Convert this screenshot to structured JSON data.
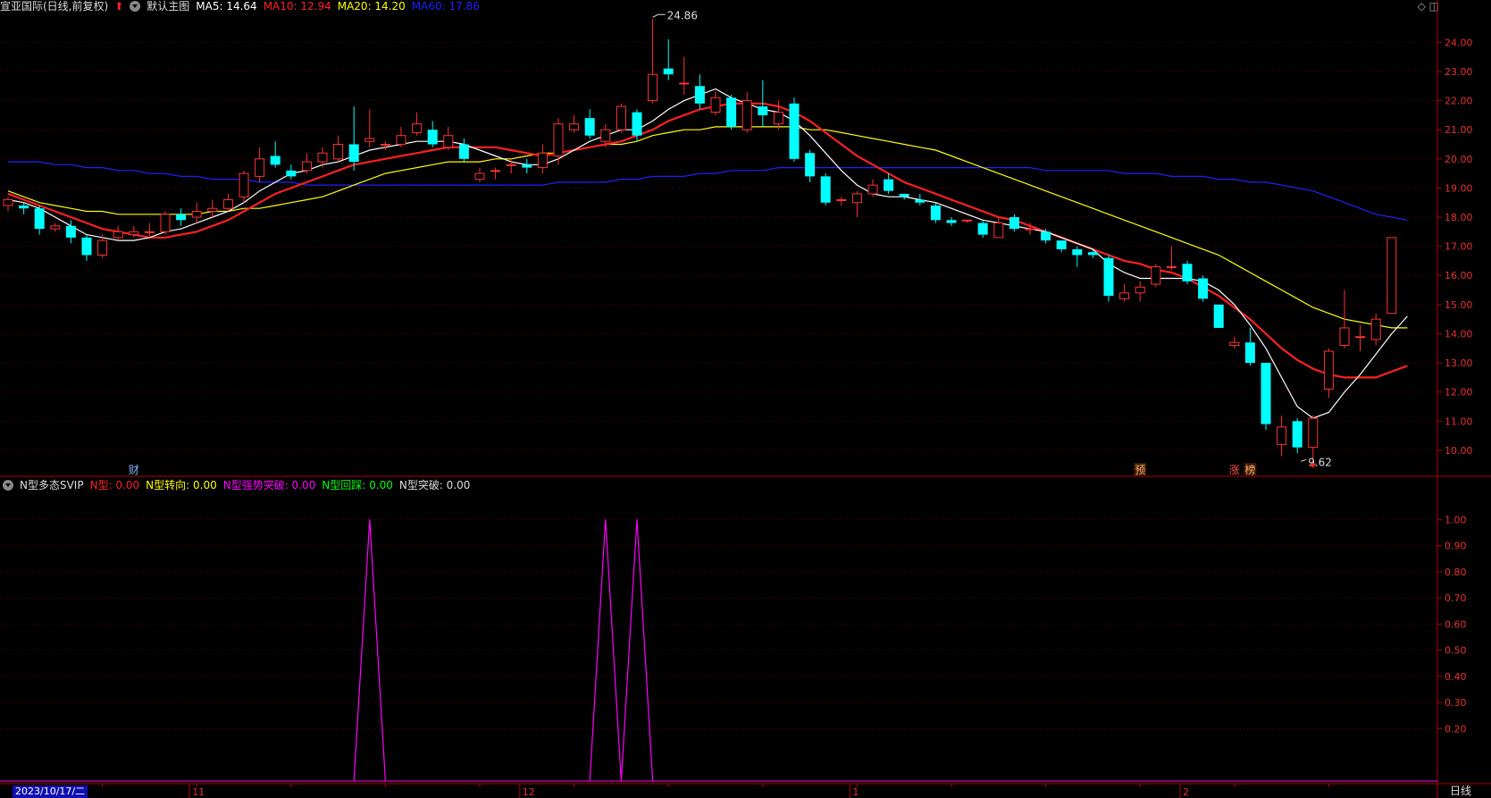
{
  "main_header": {
    "stock_title": "宣亚国际(日线,前复权)",
    "chart_name": "默认主图",
    "ma5": {
      "label": "MA5: 14.64",
      "color": "#ffffff"
    },
    "ma10": {
      "label": "MA10: 12.94",
      "color": "#ff2020"
    },
    "ma20": {
      "label": "MA20: 14.20",
      "color": "#ffff00"
    },
    "ma60": {
      "label": "MA60: 17.86",
      "color": "#2020ff"
    }
  },
  "indicator_header": {
    "name": "N型多态SVIP",
    "items": [
      {
        "label": "N型: 0.00",
        "color": "#ff2020"
      },
      {
        "label": "N型转向: 0.00",
        "color": "#ffff00"
      },
      {
        "label": "N型强势突破: 0.00",
        "color": "#ff00ff"
      },
      {
        "label": "N型回踩: 0.00",
        "color": "#00ff00"
      },
      {
        "label": "N型突破: 0.00",
        "color": "#dddddd"
      }
    ]
  },
  "top_icons": "◇ ◫",
  "price_axis": [
    "24.00",
    "23.00",
    "22.00",
    "21.00",
    "20.00",
    "19.00",
    "18.00",
    "17.00",
    "16.00",
    "15.00",
    "14.00",
    "13.00",
    "12.00",
    "11.00",
    "10.00"
  ],
  "indicator_axis": [
    "1.00",
    "0.90",
    "0.80",
    "0.70",
    "0.60",
    "0.50",
    "0.40",
    "0.30",
    "0.20"
  ],
  "annotations": {
    "high": "24.86",
    "low": "9.62"
  },
  "markers": {
    "cai": "财",
    "yu": "预",
    "zhang": "涨",
    "bang": "榜"
  },
  "x_axis": {
    "date": "2023/10/17/二",
    "months": [
      "11",
      "12",
      "1",
      "2"
    ],
    "period": "日线"
  },
  "colors": {
    "up": "#ff3232",
    "down": "#00ffff",
    "axis": "#b00000"
  },
  "chart_data": {
    "type": "candlestick",
    "price_range": [
      9.2,
      24.9
    ],
    "indicator_range": [
      0,
      1.1
    ],
    "candles": [
      [
        18.4,
        18.6,
        18.7,
        18.2
      ],
      [
        18.4,
        18.3,
        18.5,
        18.1
      ],
      [
        18.3,
        17.6,
        18.4,
        17.4
      ],
      [
        17.6,
        17.7,
        17.8,
        17.5
      ],
      [
        17.7,
        17.3,
        17.9,
        17.1
      ],
      [
        17.3,
        16.7,
        17.4,
        16.5
      ],
      [
        16.7,
        17.2,
        17.4,
        16.6
      ],
      [
        17.3,
        17.5,
        17.7,
        17.2
      ],
      [
        17.4,
        17.5,
        17.7,
        17.3
      ],
      [
        17.5,
        17.5,
        17.8,
        17.3
      ],
      [
        17.5,
        18.1,
        18.2,
        17.4
      ],
      [
        18.1,
        17.9,
        18.3,
        17.7
      ],
      [
        18.0,
        18.2,
        18.5,
        17.8
      ],
      [
        18.2,
        18.3,
        18.6,
        18.0
      ],
      [
        18.3,
        18.6,
        18.8,
        18.2
      ],
      [
        18.7,
        19.5,
        19.6,
        18.5
      ],
      [
        19.4,
        20.0,
        20.4,
        19.2
      ],
      [
        20.1,
        19.8,
        20.6,
        19.7
      ],
      [
        19.6,
        19.4,
        19.8,
        19.3
      ],
      [
        19.6,
        19.9,
        20.2,
        19.5
      ],
      [
        19.9,
        20.2,
        20.4,
        19.7
      ],
      [
        20.0,
        20.5,
        20.8,
        19.9
      ],
      [
        20.5,
        19.9,
        21.8,
        19.6
      ],
      [
        20.6,
        20.7,
        21.7,
        20.4
      ],
      [
        20.5,
        20.5,
        20.6,
        20.3
      ],
      [
        20.5,
        20.8,
        21.1,
        20.4
      ],
      [
        20.9,
        21.2,
        21.6,
        20.8
      ],
      [
        21.0,
        20.5,
        21.3,
        20.4
      ],
      [
        20.4,
        20.8,
        21.1,
        20.3
      ],
      [
        20.5,
        20.0,
        20.7,
        19.9
      ],
      [
        19.3,
        19.5,
        19.7,
        19.2
      ],
      [
        19.6,
        19.6,
        19.7,
        19.3
      ],
      [
        19.8,
        19.8,
        20.0,
        19.5
      ],
      [
        19.8,
        19.7,
        20.0,
        19.5
      ],
      [
        19.7,
        20.2,
        20.5,
        19.5
      ],
      [
        20.1,
        21.2,
        21.4,
        19.8
      ],
      [
        21.0,
        21.2,
        21.5,
        20.9
      ],
      [
        21.4,
        20.8,
        21.7,
        20.7
      ],
      [
        20.6,
        21.0,
        21.2,
        20.4
      ],
      [
        21.0,
        21.8,
        21.9,
        20.9
      ],
      [
        21.6,
        20.8,
        21.7,
        20.6
      ],
      [
        22.0,
        22.9,
        24.8,
        21.9
      ],
      [
        23.1,
        22.9,
        24.1,
        22.7
      ],
      [
        22.6,
        22.6,
        23.5,
        22.2
      ],
      [
        22.5,
        21.9,
        22.9,
        21.7
      ],
      [
        21.6,
        22.1,
        22.3,
        21.5
      ],
      [
        22.1,
        21.1,
        22.2,
        21.0
      ],
      [
        21.0,
        22.0,
        22.3,
        20.9
      ],
      [
        21.8,
        21.5,
        22.7,
        21.1
      ],
      [
        21.2,
        21.6,
        22.0,
        21.0
      ],
      [
        21.9,
        20.0,
        22.1,
        19.9
      ],
      [
        20.2,
        19.4,
        20.3,
        19.2
      ],
      [
        19.4,
        18.5,
        19.5,
        18.4
      ],
      [
        18.6,
        18.6,
        18.7,
        18.4
      ],
      [
        18.5,
        18.8,
        18.9,
        18.0
      ],
      [
        18.8,
        19.1,
        19.3,
        18.7
      ],
      [
        19.3,
        18.9,
        19.5,
        18.8
      ],
      [
        18.8,
        18.7,
        18.8,
        18.6
      ],
      [
        18.6,
        18.5,
        18.8,
        18.4
      ],
      [
        18.4,
        17.9,
        18.5,
        17.8
      ],
      [
        17.9,
        17.8,
        18.0,
        17.7
      ],
      [
        17.9,
        17.9,
        17.9,
        17.8
      ],
      [
        17.8,
        17.4,
        17.9,
        17.3
      ],
      [
        17.3,
        17.8,
        18.0,
        17.3
      ],
      [
        18.0,
        17.6,
        18.1,
        17.5
      ],
      [
        17.6,
        17.6,
        17.8,
        17.4
      ],
      [
        17.5,
        17.2,
        17.6,
        17.1
      ],
      [
        17.2,
        16.9,
        17.2,
        16.8
      ],
      [
        16.9,
        16.7,
        17.0,
        16.3
      ],
      [
        16.8,
        16.7,
        16.9,
        16.6
      ],
      [
        16.6,
        15.3,
        16.7,
        15.1
      ],
      [
        15.2,
        15.4,
        15.7,
        15.1
      ],
      [
        15.4,
        15.6,
        15.8,
        15.1
      ],
      [
        15.7,
        16.3,
        16.4,
        15.6
      ],
      [
        16.3,
        16.3,
        17.0,
        16.2
      ],
      [
        16.4,
        15.8,
        16.5,
        15.7
      ],
      [
        15.9,
        15.2,
        16.0,
        15.1
      ],
      [
        15.0,
        14.2,
        15.0,
        14.2
      ],
      [
        13.6,
        13.7,
        13.9,
        13.5
      ],
      [
        13.7,
        13.0,
        14.2,
        12.9
      ],
      [
        13.0,
        10.9,
        13.0,
        10.7
      ],
      [
        10.2,
        10.8,
        11.2,
        9.8
      ],
      [
        11.0,
        10.1,
        11.1,
        9.9
      ],
      [
        10.1,
        11.1,
        11.2,
        9.6
      ],
      [
        12.1,
        13.4,
        13.5,
        11.8
      ],
      [
        13.6,
        14.2,
        15.5,
        13.5
      ],
      [
        13.9,
        13.9,
        14.3,
        13.4
      ],
      [
        13.8,
        14.5,
        14.7,
        13.6
      ],
      [
        14.7,
        17.3,
        17.3,
        14.7
      ]
    ],
    "ma5": [
      18.6,
      18.5,
      18.3,
      18.0,
      17.7,
      17.4,
      17.3,
      17.2,
      17.2,
      17.3,
      17.5,
      17.6,
      17.8,
      18.0,
      18.2,
      18.5,
      18.9,
      19.2,
      19.5,
      19.6,
      19.8,
      19.9,
      20.1,
      20.3,
      20.4,
      20.5,
      20.6,
      20.6,
      20.6,
      20.5,
      20.3,
      20.1,
      19.9,
      19.8,
      19.8,
      20.0,
      20.3,
      20.6,
      20.8,
      21.0,
      21.0,
      21.3,
      21.7,
      22.0,
      22.2,
      22.4,
      22.1,
      21.9,
      21.7,
      21.6,
      21.3,
      20.8,
      20.2,
      19.6,
      19.1,
      18.8,
      18.7,
      18.7,
      18.6,
      18.5,
      18.3,
      18.1,
      17.9,
      17.8,
      17.7,
      17.6,
      17.5,
      17.3,
      17.1,
      16.9,
      16.4,
      16.1,
      15.9,
      15.9,
      15.9,
      15.9,
      15.8,
      15.5,
      15.0,
      14.3,
      13.5,
      12.5,
      11.5,
      11.1,
      11.3,
      12.0,
      12.6,
      13.3,
      14.0,
      14.6
    ],
    "ma10": [
      18.8,
      18.6,
      18.4,
      18.2,
      18.0,
      17.8,
      17.6,
      17.5,
      17.4,
      17.3,
      17.3,
      17.4,
      17.5,
      17.7,
      17.9,
      18.2,
      18.5,
      18.8,
      19.0,
      19.2,
      19.4,
      19.6,
      19.8,
      19.9,
      20.0,
      20.1,
      20.2,
      20.3,
      20.4,
      20.4,
      20.4,
      20.4,
      20.3,
      20.2,
      20.1,
      20.2,
      20.3,
      20.4,
      20.5,
      20.6,
      20.8,
      21.0,
      21.3,
      21.5,
      21.7,
      21.8,
      21.9,
      21.9,
      21.9,
      21.8,
      21.6,
      21.3,
      20.9,
      20.5,
      20.1,
      19.8,
      19.5,
      19.2,
      19.0,
      18.8,
      18.6,
      18.4,
      18.2,
      18.0,
      17.9,
      17.7,
      17.5,
      17.3,
      17.1,
      16.9,
      16.7,
      16.5,
      16.4,
      16.2,
      16.1,
      15.9,
      15.6,
      15.3,
      14.9,
      14.5,
      14.0,
      13.5,
      13.1,
      12.8,
      12.6,
      12.5,
      12.5,
      12.5,
      12.7,
      12.9
    ],
    "ma20": [
      18.9,
      18.7,
      18.5,
      18.4,
      18.3,
      18.2,
      18.2,
      18.1,
      18.1,
      18.1,
      18.1,
      18.1,
      18.1,
      18.2,
      18.2,
      18.3,
      18.3,
      18.4,
      18.5,
      18.6,
      18.7,
      18.9,
      19.1,
      19.3,
      19.5,
      19.6,
      19.7,
      19.8,
      19.9,
      19.9,
      19.9,
      20.0,
      20.0,
      20.1,
      20.2,
      20.2,
      20.3,
      20.4,
      20.5,
      20.5,
      20.6,
      20.8,
      20.9,
      21.0,
      21.0,
      21.1,
      21.1,
      21.1,
      21.1,
      21.1,
      21.1,
      21.0,
      21.0,
      20.9,
      20.8,
      20.7,
      20.6,
      20.5,
      20.4,
      20.3,
      20.1,
      19.9,
      19.7,
      19.5,
      19.3,
      19.1,
      18.9,
      18.7,
      18.5,
      18.3,
      18.1,
      17.9,
      17.7,
      17.5,
      17.3,
      17.1,
      16.9,
      16.7,
      16.4,
      16.1,
      15.8,
      15.5,
      15.2,
      14.9,
      14.7,
      14.5,
      14.4,
      14.3,
      14.2,
      14.2
    ],
    "ma60": [
      19.9,
      19.9,
      19.9,
      19.8,
      19.8,
      19.7,
      19.7,
      19.6,
      19.6,
      19.5,
      19.5,
      19.4,
      19.4,
      19.3,
      19.3,
      19.3,
      19.2,
      19.2,
      19.2,
      19.1,
      19.1,
      19.1,
      19.1,
      19.1,
      19.1,
      19.1,
      19.1,
      19.1,
      19.1,
      19.1,
      19.1,
      19.1,
      19.1,
      19.1,
      19.1,
      19.2,
      19.2,
      19.2,
      19.2,
      19.3,
      19.3,
      19.4,
      19.4,
      19.4,
      19.5,
      19.5,
      19.6,
      19.6,
      19.6,
      19.7,
      19.7,
      19.7,
      19.7,
      19.7,
      19.7,
      19.7,
      19.7,
      19.7,
      19.7,
      19.7,
      19.7,
      19.7,
      19.7,
      19.7,
      19.7,
      19.7,
      19.6,
      19.6,
      19.6,
      19.6,
      19.6,
      19.5,
      19.5,
      19.5,
      19.4,
      19.4,
      19.4,
      19.3,
      19.3,
      19.2,
      19.2,
      19.1,
      19.0,
      18.9,
      18.7,
      18.5,
      18.3,
      18.1,
      18.0,
      17.9
    ],
    "indicator_peaks": [
      {
        "index": 23,
        "value": 1.0
      },
      {
        "index": 38,
        "value": 1.0
      },
      {
        "index": 40,
        "value": 1.0
      }
    ]
  }
}
